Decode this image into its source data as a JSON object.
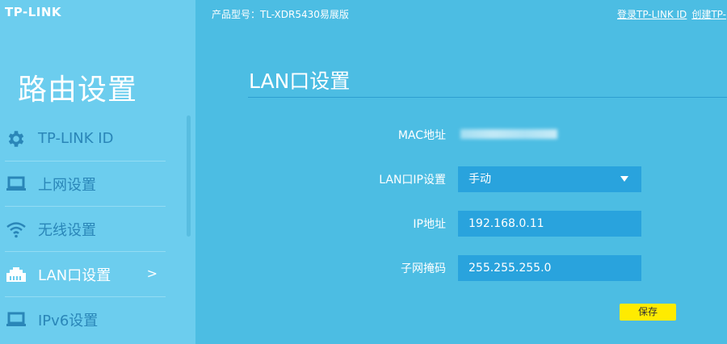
{
  "brand": {
    "logo_text": "TP-LINK"
  },
  "header": {
    "model_text": "产品型号：TL-XDR5430易展版",
    "login_link": "登录TP-LINK ID",
    "create_link": "创建TP-"
  },
  "sidebar": {
    "title": "路由设置",
    "items": [
      {
        "label": "TP-LINK ID",
        "icon": "gear-icon",
        "active": false
      },
      {
        "label": "上网设置",
        "icon": "laptop-icon",
        "active": false
      },
      {
        "label": "无线设置",
        "icon": "wifi-icon",
        "active": false
      },
      {
        "label": "LAN口设置",
        "icon": "lan-port-icon",
        "active": true,
        "arrow": ">"
      },
      {
        "label": "IPv6设置",
        "icon": "laptop-icon",
        "active": false
      }
    ]
  },
  "main": {
    "title": "LAN口设置",
    "mac_label": "MAC地址",
    "lan_ip_label": "LAN口IP设置",
    "lan_ip_mode": "手动",
    "ip_label": "IP地址",
    "ip_value": "192.168.0.11",
    "mask_label": "子网掩码",
    "mask_value": "255.255.255.0",
    "save_label": "保存"
  },
  "colors": {
    "background": "#4cbde3",
    "sidebar": "#6ccdee",
    "field": "#29a3dd",
    "inactive_menu_text": "#2a86b8",
    "save_button": "#ffeb00"
  }
}
